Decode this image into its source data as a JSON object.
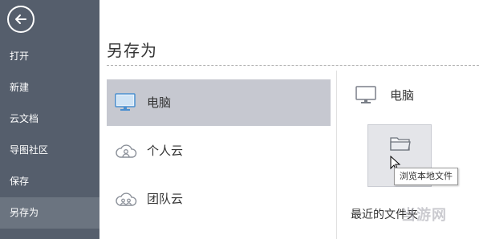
{
  "sidebar": {
    "items": [
      {
        "label": "打开"
      },
      {
        "label": "新建"
      },
      {
        "label": "云文档"
      },
      {
        "label": "导图社区"
      },
      {
        "label": "保存"
      },
      {
        "label": "另存为",
        "active": true
      }
    ]
  },
  "main": {
    "title": "另存为",
    "locations": [
      {
        "label": "电脑",
        "icon": "monitor-icon",
        "selected": true
      },
      {
        "label": "个人云",
        "icon": "cloud-person-icon"
      },
      {
        "label": "团队云",
        "icon": "cloud-team-icon"
      }
    ],
    "right": {
      "title": "电脑",
      "browse_tooltip": "浏览本地文件",
      "recent_label": "最近的文件夹"
    }
  },
  "watermark": "当游网",
  "colors": {
    "sidebar": "#555e6c",
    "sidebar_active": "#6b7480",
    "selected_item": "#c6c8d0"
  }
}
